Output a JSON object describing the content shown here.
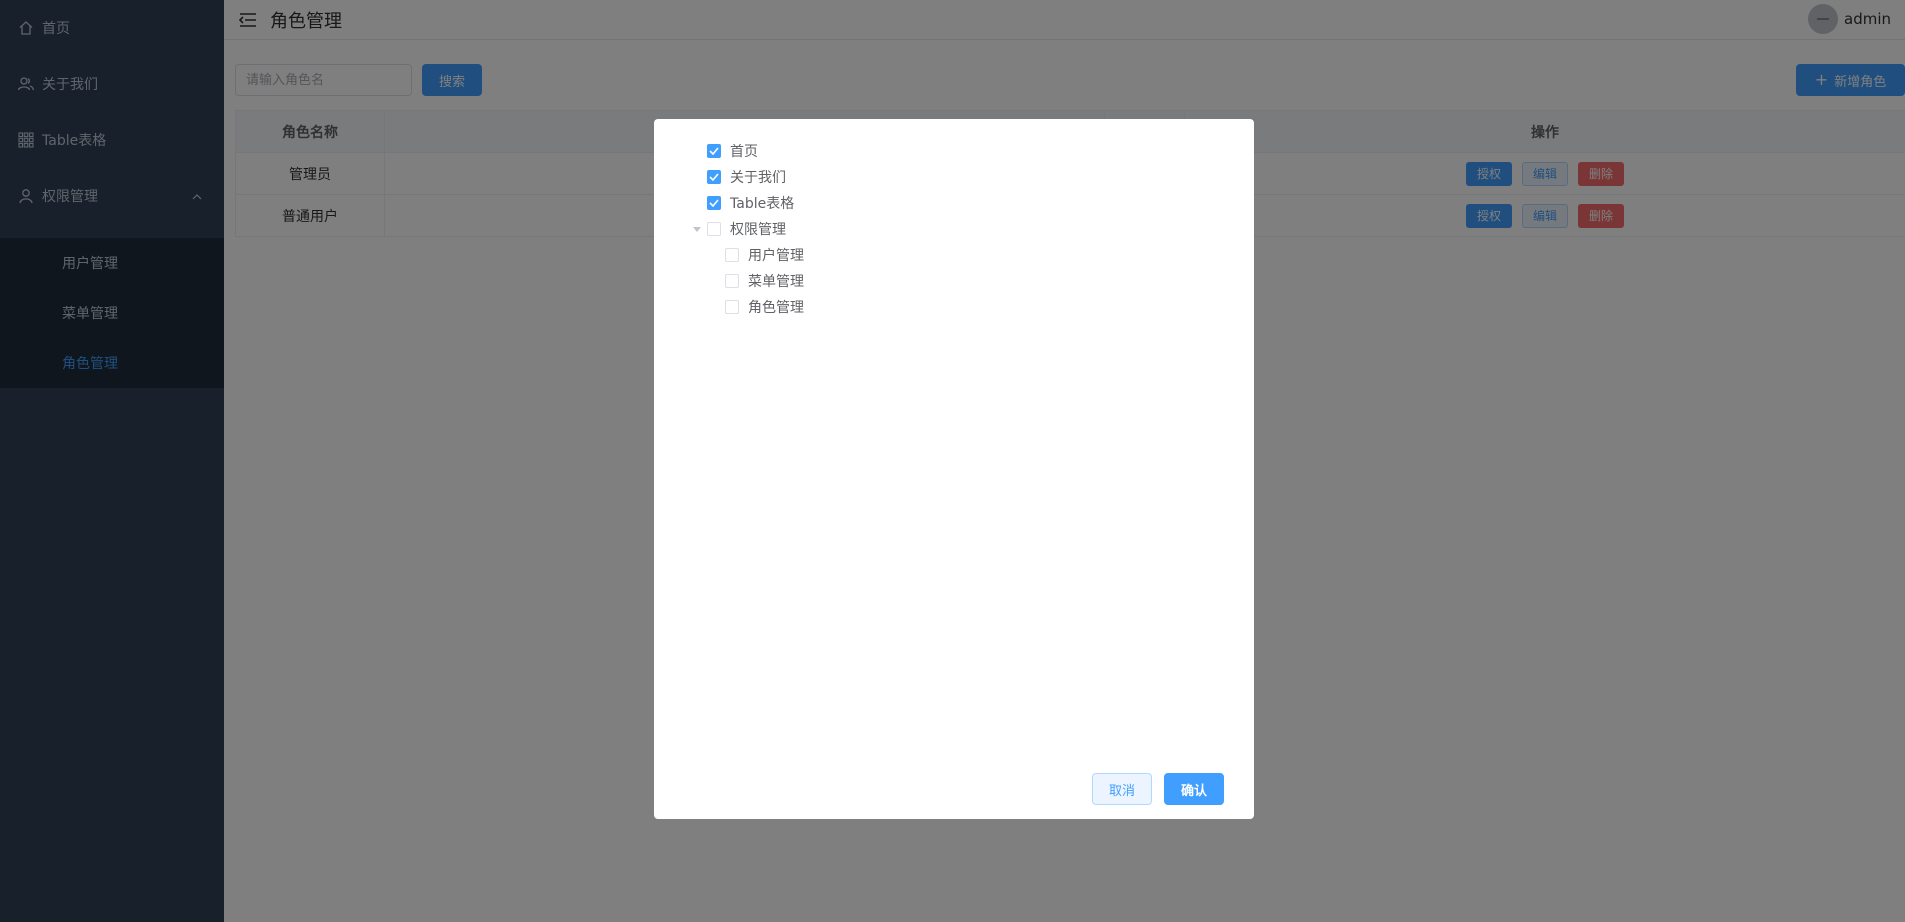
{
  "sidebar": {
    "items": [
      {
        "label": "首页",
        "icon": "home-icon"
      },
      {
        "label": "关于我们",
        "icon": "users-icon"
      },
      {
        "label": "Table表格",
        "icon": "grid-icon"
      },
      {
        "label": "权限管理",
        "icon": "user-icon"
      }
    ],
    "submenu": [
      {
        "label": "用户管理"
      },
      {
        "label": "菜单管理"
      },
      {
        "label": "角色管理",
        "active": true
      }
    ]
  },
  "header": {
    "title": "角色管理",
    "username": "admin"
  },
  "toolbar": {
    "search_placeholder": "请输入角色名",
    "search_label": "搜索",
    "add_label": "新增角色"
  },
  "table": {
    "headers": [
      "角色名称",
      "",
      "",
      "操作"
    ],
    "rows": [
      {
        "name": "管理员"
      },
      {
        "name": "普通用户"
      }
    ],
    "actions": {
      "auth": "授权",
      "edit": "编辑",
      "delete": "删除"
    }
  },
  "dialog": {
    "tree": [
      {
        "label": "首页",
        "checked": true,
        "level": 0
      },
      {
        "label": "关于我们",
        "checked": true,
        "level": 0
      },
      {
        "label": "Table表格",
        "checked": true,
        "level": 0
      },
      {
        "label": "权限管理",
        "checked": false,
        "level": 0,
        "expanded": true
      },
      {
        "label": "用户管理",
        "checked": false,
        "level": 1
      },
      {
        "label": "菜单管理",
        "checked": false,
        "level": 1
      },
      {
        "label": "角色管理",
        "checked": false,
        "level": 1
      }
    ],
    "cancel_label": "取消",
    "confirm_label": "确认"
  },
  "colors": {
    "sidebar_bg": "#304156",
    "submenu_bg": "#1f2d3d",
    "accent": "#409eff",
    "danger": "#f56c6c"
  }
}
